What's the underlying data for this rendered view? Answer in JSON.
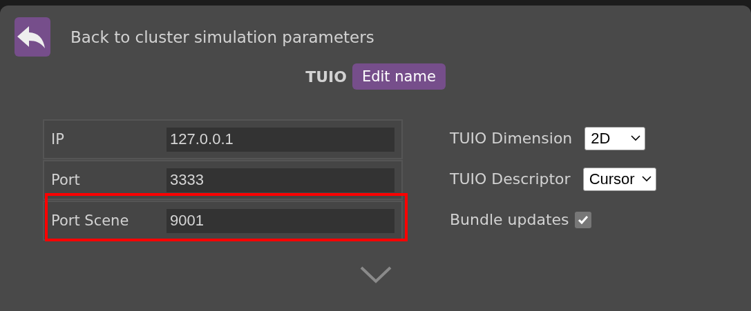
{
  "back_button": {
    "label": "Back to cluster simulation parameters"
  },
  "device": {
    "name": "TUIO",
    "edit_button": "Edit name"
  },
  "fields": [
    {
      "label": "IP",
      "value": "127.0.0.1",
      "highlighted": false
    },
    {
      "label": "Port",
      "value": "3333",
      "highlighted": false
    },
    {
      "label": "Port Scene",
      "value": "9001",
      "highlighted": true
    }
  ],
  "options": [
    {
      "kind": "select",
      "label": "TUIO Dimension",
      "value": "2D"
    },
    {
      "kind": "select",
      "label": "TUIO Descriptor",
      "value": "Cursor"
    },
    {
      "kind": "checkbox",
      "label": "Bundle updates",
      "checked": true
    }
  ]
}
